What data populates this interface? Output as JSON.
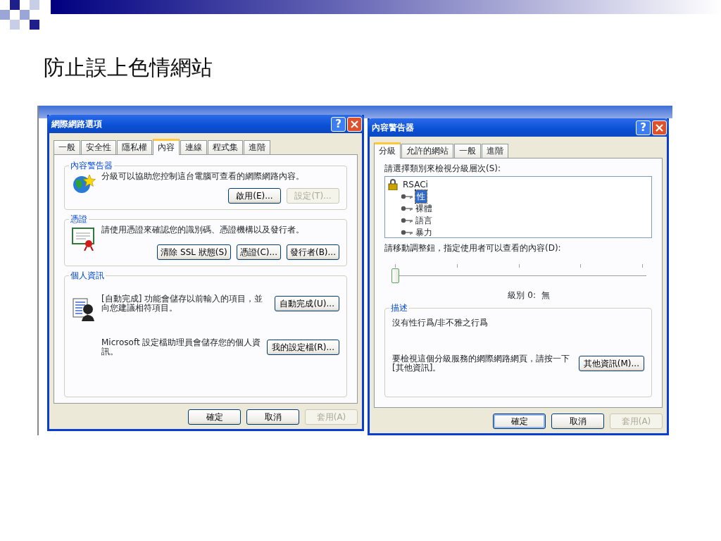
{
  "slide": {
    "title": "防止誤上色情網站"
  },
  "internet_options": {
    "title": "網際網路選項",
    "help": "?",
    "tabs": [
      {
        "label": "一般",
        "selected": false
      },
      {
        "label": "安全性",
        "selected": false
      },
      {
        "label": "隱私權",
        "selected": false
      },
      {
        "label": "內容",
        "selected": true
      },
      {
        "label": "連線",
        "selected": false
      },
      {
        "label": "程式集",
        "selected": false
      },
      {
        "label": "進階",
        "selected": false
      }
    ],
    "groups": [
      {
        "kind": "ratings",
        "title": "內容警告器",
        "rows": [
          {
            "text": "分級可以協助您控制這台電腦可查看的網際網路內容。"
          }
        ],
        "buttons": [
          {
            "label": "啟用(E)...",
            "disabled": false
          },
          {
            "label": "設定(T)...",
            "disabled": true
          }
        ]
      },
      {
        "kind": "certificates",
        "title": "憑證",
        "rows": [
          {
            "text": "請使用憑證來確認您的識別碼、憑證機構以及發行者。"
          }
        ],
        "buttons": [
          {
            "label": "清除 SSL 狀態(S)",
            "disabled": false
          },
          {
            "label": "憑證(C)...",
            "disabled": false
          },
          {
            "label": "發行者(B)...",
            "disabled": false
          }
        ]
      },
      {
        "kind": "personal",
        "title": "個人資訊",
        "rows": [
          {
            "text": "[自動完成] 功能會儲存以前輸入的項目，並向您建議相符項目。",
            "buttons": [
              {
                "label": "自動完成(U)...",
                "disabled": false
              }
            ]
          },
          {
            "text": "Microsoft 設定檔助理員會儲存您的個人資訊。",
            "buttons": [
              {
                "label": "我的設定檔(R)...",
                "disabled": false
              }
            ]
          }
        ]
      }
    ],
    "buttons": [
      {
        "label": "確定",
        "disabled": false,
        "default": false
      },
      {
        "label": "取消",
        "disabled": false,
        "default": false
      },
      {
        "label": "套用(A)",
        "disabled": true,
        "default": false
      }
    ]
  },
  "content_advisor": {
    "title": "內容警告器",
    "help": "?",
    "tabs": [
      {
        "label": "分級",
        "selected": true
      },
      {
        "label": "允許的網站",
        "selected": false
      },
      {
        "label": "一般",
        "selected": false
      },
      {
        "label": "進階",
        "selected": false
      }
    ],
    "category_label": "請選擇類別來檢視分級層次(S):",
    "tree": [
      {
        "label": "RSACi",
        "selected": false,
        "children": [
          {
            "label": "性",
            "selected": true
          },
          {
            "label": "裸體",
            "selected": false
          },
          {
            "label": "語言",
            "selected": false
          },
          {
            "label": "暴力",
            "selected": false
          }
        ]
      }
    ],
    "slider_label": "請移動調整鈕，指定使用者可以查看的內容(D):",
    "slider": {
      "level": 0
    },
    "level_text": "級別 0:  無",
    "description": {
      "title": "描述",
      "text": "沒有性行爲/非不雅之行爲",
      "more_text": "要檢視這個分級服務的網際網路網頁，請按一下 [其他資訊]。",
      "more_button": "其他資訊(M)..."
    },
    "buttons": [
      {
        "label": "確定",
        "disabled": false,
        "default": true
      },
      {
        "label": "取消",
        "disabled": false,
        "default": false
      },
      {
        "label": "套用(A)",
        "disabled": true,
        "default": false
      }
    ]
  }
}
